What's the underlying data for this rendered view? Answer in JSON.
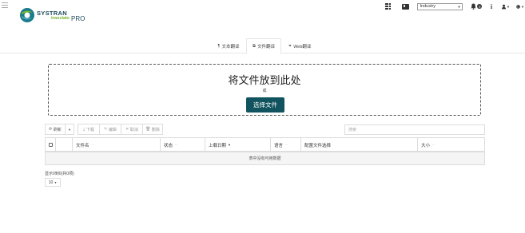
{
  "header": {
    "logo": {
      "brand": "SYSTRAN",
      "product_sub": "translate",
      "product_tier": "PRO"
    },
    "industry_select": {
      "value": "Industry"
    },
    "notifications_count": "0",
    "info_label": "i"
  },
  "tabs": [
    {
      "label": "文本翻译",
      "icon": "paragraph-icon",
      "active": false
    },
    {
      "label": "文件翻译",
      "icon": "files-icon",
      "active": true
    },
    {
      "label": "Web翻译",
      "icon": "link-icon",
      "active": false
    }
  ],
  "dropzone": {
    "title": "将文件放到此处",
    "or": "或",
    "button": "选择文件"
  },
  "toolbar": {
    "refresh": "刷新",
    "download": "下载",
    "edit": "编辑",
    "cancel": "取消",
    "delete": "删除"
  },
  "search": {
    "placeholder": "搜索"
  },
  "table": {
    "columns": [
      {
        "label": "文件名",
        "sort": "--"
      },
      {
        "label": "状态",
        "sort": "--"
      },
      {
        "label": "上载日期",
        "sort": "desc"
      },
      {
        "label": "语言",
        "sort": "--"
      },
      {
        "label": "配置文件选择",
        "sort": ""
      },
      {
        "label": "大小",
        "sort": "--"
      }
    ],
    "empty_message": "表中没有可用数据"
  },
  "footer": {
    "info": "显示0到0(共0项)",
    "page_size": "10"
  },
  "colors": {
    "primary": "#11535f",
    "brand_green": "#7ab62f"
  }
}
